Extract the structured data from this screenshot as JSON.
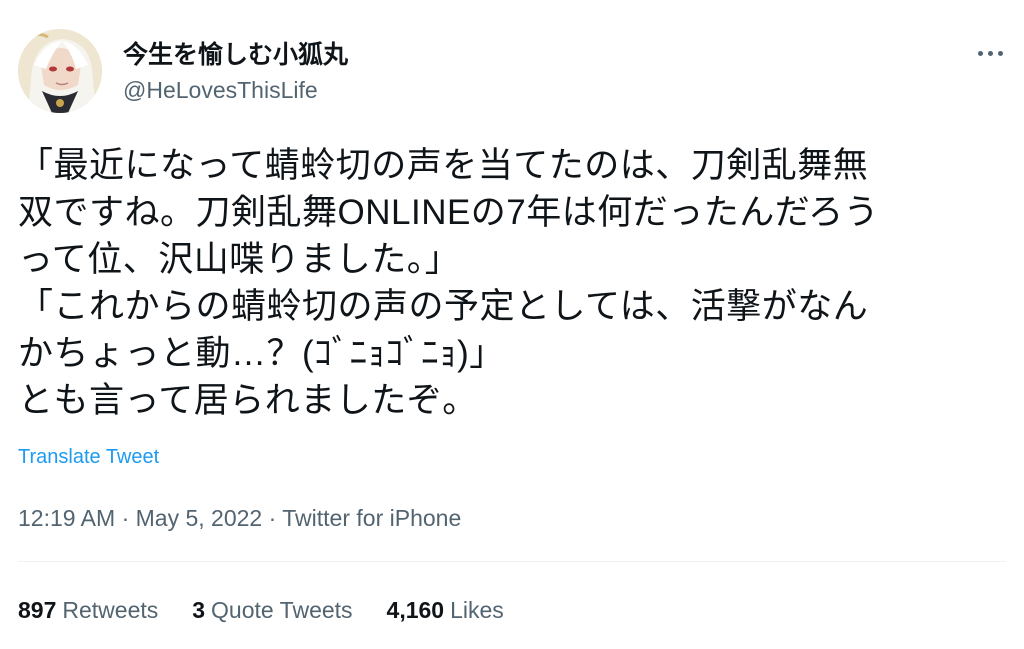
{
  "user": {
    "display_name": "今生を愉しむ小狐丸",
    "handle": "@HeLovesThisLife",
    "avatar_icon": "avatar-image"
  },
  "tweet": {
    "text": "「最近になって蜻蛉切の声を当てたのは、刀剣乱舞無\n双ですね。刀剣乱舞ONLINEの7年は何だったんだろう\nって位、沢山喋りました。」\n「これからの蜻蛉切の声の予定としては、活撃がなん\nかちょっと動…？(ｺﾞﾆｮｺﾞﾆｮ)」\nとも言って居られましたぞ。",
    "translate_label": "Translate Tweet"
  },
  "meta": {
    "time": "12:19 AM",
    "separator": "·",
    "date": "May 5, 2022",
    "source": "Twitter for iPhone"
  },
  "stats": {
    "retweets_count": "897",
    "retweets_label": "Retweets",
    "quotes_count": "3",
    "quotes_label": "Quote Tweets",
    "likes_count": "4,160",
    "likes_label": "Likes"
  },
  "colors": {
    "text_primary": "#0f1419",
    "text_secondary": "#536471",
    "link": "#1d9bf0",
    "divider": "#eff3f4"
  }
}
